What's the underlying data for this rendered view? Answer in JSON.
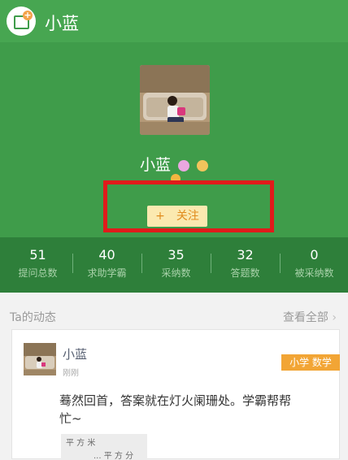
{
  "topbar": {
    "title": "小蓝",
    "back_icon": "app-logo-icon"
  },
  "profile": {
    "name": "小蓝",
    "subtitle": "",
    "follow_label": "关注",
    "follow_plus": "+"
  },
  "stats": [
    {
      "value": "51",
      "label": "提问总数"
    },
    {
      "value": "40",
      "label": "求助学霸"
    },
    {
      "value": "35",
      "label": "采纳数"
    },
    {
      "value": "32",
      "label": "答题数"
    },
    {
      "value": "0",
      "label": "被采纳数"
    }
  ],
  "activity": {
    "title": "Ta的动态",
    "view_all": "查看全部",
    "view_all_arrow": "›"
  },
  "post": {
    "user": "小蓝",
    "time": "刚刚",
    "tag": "小学 数学",
    "text": "蓦然回首，答案就在灯火阑珊处。学霸帮帮忙~",
    "image_text_1": "平 方 米",
    "image_text_2": "... 平 方 分"
  },
  "colors": {
    "header_green": "#47a651",
    "profile_green": "#3f9c4a",
    "stats_green": "#2e7f3a",
    "follow_bg": "#fbe9b0",
    "follow_text": "#e08b1d",
    "tag_orange": "#f2a535",
    "highlight_red": "#e01b1b"
  }
}
